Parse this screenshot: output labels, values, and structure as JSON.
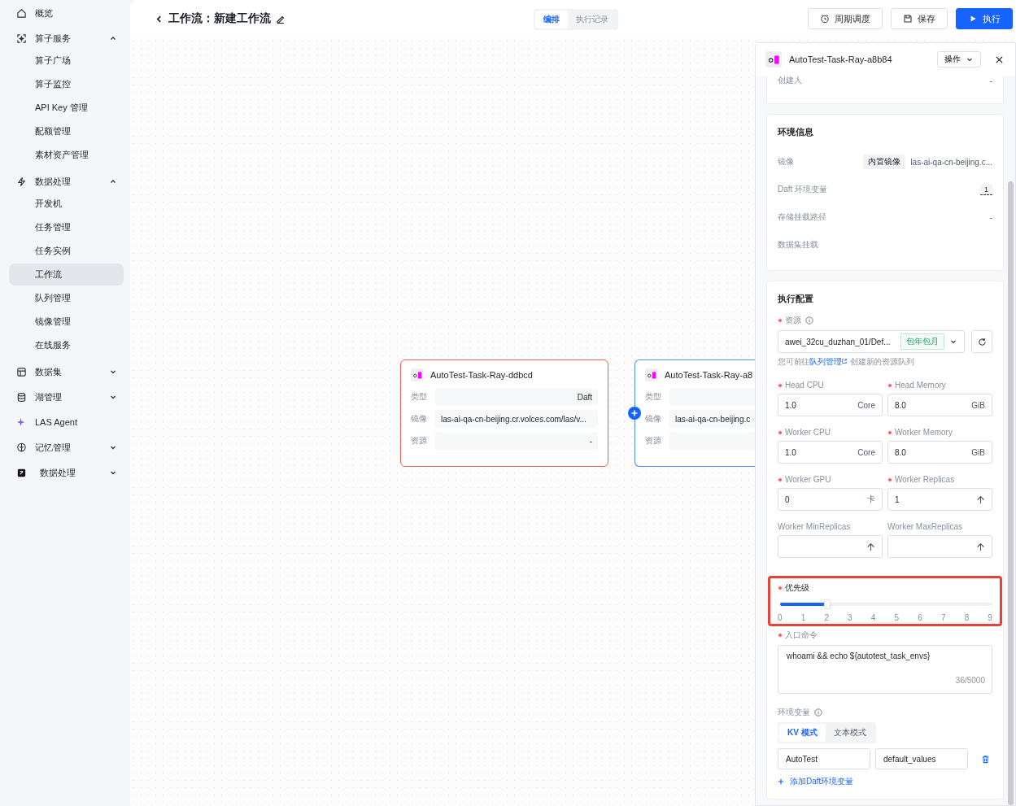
{
  "sidebar": {
    "items": [
      {
        "label": "概览",
        "selected": false
      },
      {
        "label": "算子服务",
        "expanded": true,
        "children": [
          {
            "label": "算子广场",
            "selected": false
          },
          {
            "label": "算子监控",
            "selected": false
          },
          {
            "label": "API Key 管理",
            "selected": false
          },
          {
            "label": "配额管理",
            "selected": false
          },
          {
            "label": "素材资产管理",
            "selected": false
          }
        ]
      },
      {
        "label": "数据处理",
        "expanded": true,
        "children": [
          {
            "label": "开发机",
            "selected": false
          },
          {
            "label": "任务管理",
            "selected": false
          },
          {
            "label": "任务实例",
            "selected": false
          },
          {
            "label": "工作流",
            "selected": true
          },
          {
            "label": "队列管理",
            "selected": false
          },
          {
            "label": "镜像管理",
            "selected": false
          },
          {
            "label": "在线服务",
            "selected": false
          }
        ]
      },
      {
        "label": "数据集",
        "expanded": false
      },
      {
        "label": "湖管理",
        "expanded": false
      },
      {
        "label": "LAS Agent",
        "selected": false
      },
      {
        "label": "记忆管理",
        "expanded": false
      },
      {
        "label": "数据处理",
        "expanded": false
      }
    ]
  },
  "header": {
    "title": "工作流：新建工作流",
    "tabs": [
      {
        "label": "编排",
        "selected": true
      },
      {
        "label": "执行记录",
        "selected": false
      }
    ],
    "buttons": [
      {
        "label": "周期调度",
        "kind": "default"
      },
      {
        "label": "保存",
        "kind": "default"
      },
      {
        "label": "执行",
        "kind": "primary"
      }
    ]
  },
  "canvas": {
    "nodes": [
      {
        "title": "AutoTest-Task-Ray-ddbcd",
        "error": true,
        "selected": false,
        "fields": [
          {
            "label": "类型",
            "value": "Daft"
          },
          {
            "label": "镜像",
            "value": "las-ai-qa-cn-beijing.cr.volces.com/las/v..."
          },
          {
            "label": "资源",
            "value": "-"
          }
        ]
      },
      {
        "title": "AutoTest-Task-Ray-a8",
        "error": false,
        "selected": true,
        "fields": [
          {
            "label": "类型"
          },
          {
            "label": "镜像",
            "value": "las-ai-qa-cn-beijing.c"
          },
          {
            "label": "资源"
          }
        ]
      }
    ]
  },
  "panel": {
    "title": "AutoTest-Task-Ray-a8b84",
    "action": "操作",
    "creator": {
      "label": "创建人",
      "value": "-"
    },
    "env_info": {
      "title": "环境信息",
      "rows": [
        {
          "label": "镜像",
          "tag": "内置镜像",
          "value": "las-ai-qa-cn-beijing.c..."
        },
        {
          "label": "Daft 环境变量",
          "count": "1"
        },
        {
          "label": "存储挂载路径",
          "value": "-"
        },
        {
          "label": "数据集挂载"
        }
      ]
    },
    "exec_config": {
      "title": "执行配置",
      "resource": {
        "label": "资源",
        "required": true,
        "value": "awei_32cu_duzhan_01/Def...",
        "tag": "包年包月",
        "hint_before": "您可前往",
        "hint_link": "队列管理",
        "hint_after": "创建新的资源队列"
      },
      "fields": [
        {
          "label": "Head CPU",
          "required": true,
          "kind": "unit",
          "value": "1.0",
          "unit": "Core"
        },
        {
          "label": "Head Memory",
          "required": true,
          "kind": "unit",
          "value": "8.0",
          "unit": "GiB"
        },
        {
          "label": "Worker CPU",
          "required": true,
          "kind": "unit",
          "value": "1.0",
          "unit": "Core"
        },
        {
          "label": "Worker Memory",
          "required": true,
          "kind": "unit",
          "value": "8.0",
          "unit": "GiB"
        },
        {
          "label": "Worker GPU",
          "required": true,
          "kind": "unit",
          "value": "0",
          "unit": "卡"
        },
        {
          "label": "Worker Replicas",
          "required": true,
          "kind": "stepper",
          "value": "1"
        },
        {
          "label": "Worker MinReplicas",
          "required": false,
          "kind": "stepper"
        },
        {
          "label": "Worker MaxReplicas",
          "required": false,
          "kind": "stepper"
        }
      ],
      "priority": {
        "label": "优先级",
        "required": true,
        "highlighted": true,
        "level": 0.222,
        "ticks": [
          "0",
          "1",
          "2",
          "3",
          "4",
          "5",
          "6",
          "7",
          "8",
          "9"
        ]
      },
      "command": {
        "label": "入口命令",
        "required": true,
        "value": "whoami && echo ${autotest_task_envs}",
        "counter": "36/5000"
      },
      "env_vars": {
        "label": "环境变量",
        "modes": [
          {
            "label": "KV 模式",
            "selected": true
          },
          {
            "label": "文本模式",
            "selected": false
          }
        ],
        "rows": [
          {
            "key": "AutoTest",
            "value": "default_values"
          }
        ],
        "add": "添加Daft环境变量"
      }
    }
  }
}
